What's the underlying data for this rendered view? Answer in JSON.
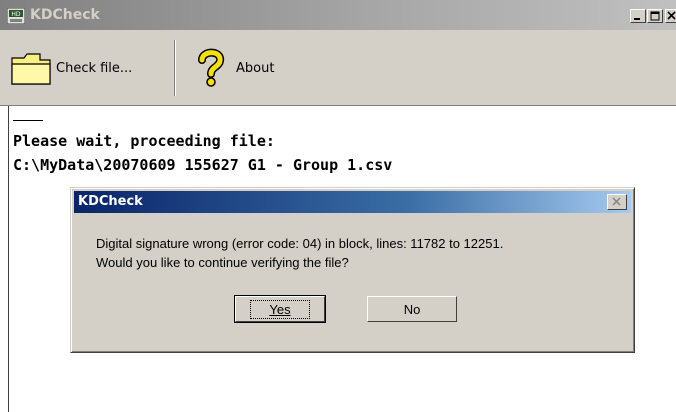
{
  "window": {
    "title": "KDCheck",
    "app_icon_text": "HD"
  },
  "toolbar": {
    "check_file_label": "Check file...",
    "about_label": "About"
  },
  "status": {
    "line1": "Please wait, proceeding file:",
    "line2": "C:\\MyData\\20070609 155627 G1 - Group 1.csv"
  },
  "dialog": {
    "title": "KDCheck",
    "message_line1": "Digital signature wrong (error code: 04) in block, lines: 11782 to 12251.",
    "message_line2": "Would you like to continue verifying the file?",
    "yes_label": "Yes",
    "no_label": "No"
  },
  "colors": {
    "face": "#d4d0c8",
    "dialog_title_start": "#0a246a",
    "dialog_title_end": "#a6caf0",
    "folder_yellow": "#f8f080"
  }
}
